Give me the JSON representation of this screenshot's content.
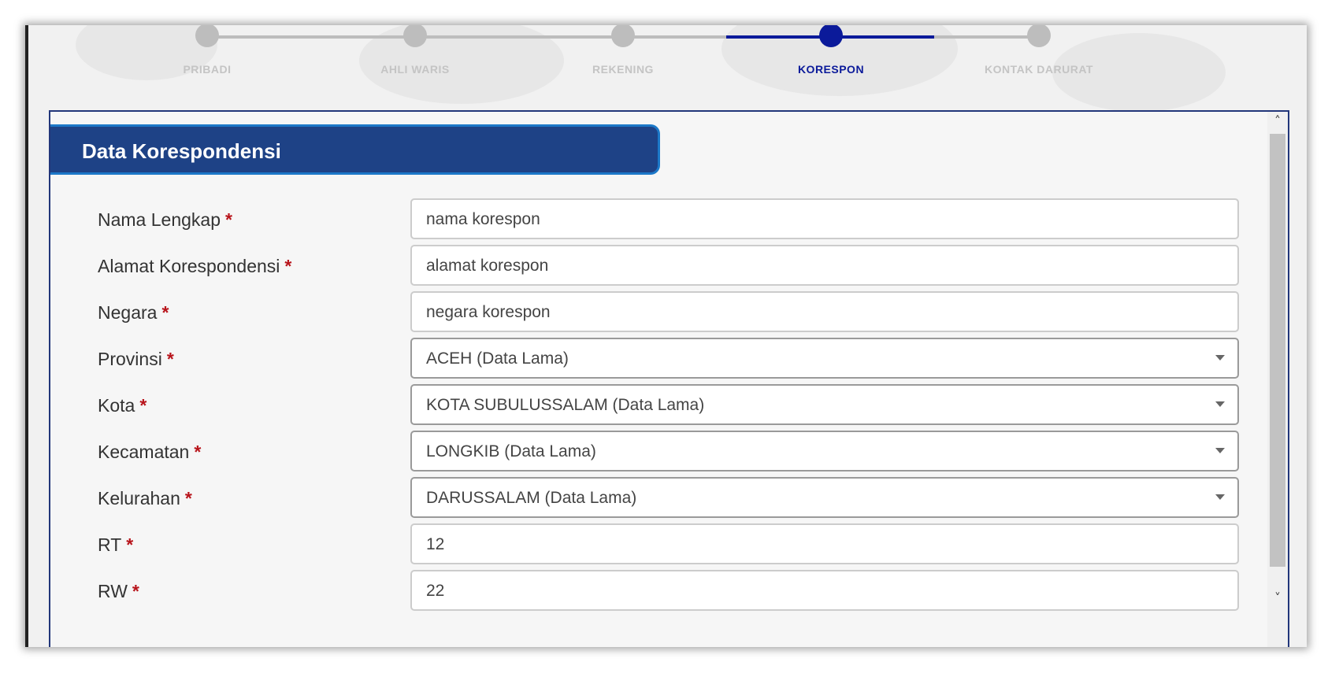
{
  "stepper": {
    "steps": [
      {
        "label": "PRIBADI",
        "state": "inactive"
      },
      {
        "label": "AHLI WARIS",
        "state": "inactive"
      },
      {
        "label": "REKENING",
        "state": "inactive"
      },
      {
        "label": "KORESPON",
        "state": "active"
      },
      {
        "label": "KONTAK DARURAT",
        "state": "inactive"
      }
    ],
    "active_color": "#0b1a9a",
    "inactive_color": "#bdbdbd"
  },
  "section": {
    "title": "Data Korespondensi",
    "header_color": "#1e4286"
  },
  "required_marker": "*",
  "form": {
    "nama": {
      "label": "Nama Lengkap",
      "value": "nama korespon"
    },
    "alamat": {
      "label": "Alamat Korespondensi",
      "value": "alamat korespon"
    },
    "negara": {
      "label": "Negara",
      "value": "negara korespon"
    },
    "provinsi": {
      "label": "Provinsi",
      "value": "ACEH (Data Lama)"
    },
    "kota": {
      "label": "Kota",
      "value": "KOTA SUBULUSSALAM (Data Lama)"
    },
    "kecamatan": {
      "label": "Kecamatan",
      "value": "LONGKIB (Data Lama)"
    },
    "kelurahan": {
      "label": "Kelurahan",
      "value": "DARUSSALAM (Data Lama)"
    },
    "rt": {
      "label": "RT",
      "value": "12"
    },
    "rw": {
      "label": "RW",
      "value": "22"
    }
  },
  "icons": {
    "scroll_up": "chevron-up-icon",
    "scroll_down": "chevron-down-icon",
    "select_caret": "caret-down-icon"
  }
}
